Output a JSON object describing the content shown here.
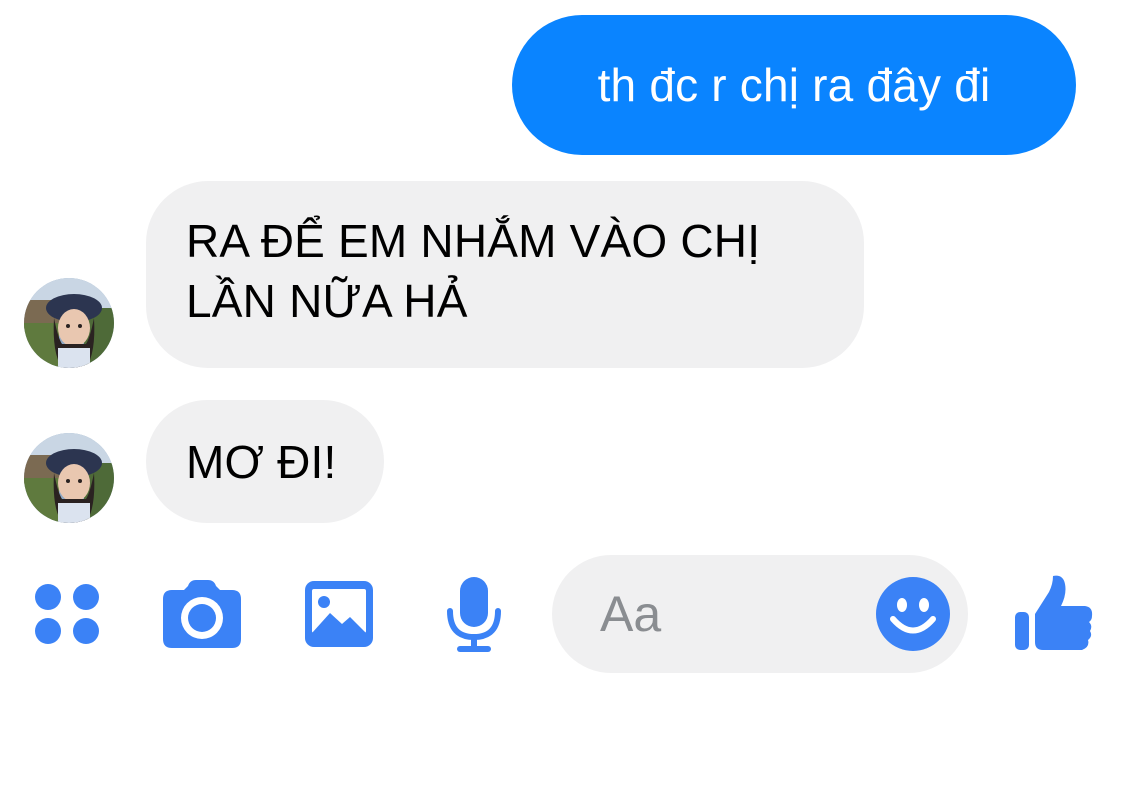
{
  "messages": [
    {
      "direction": "outgoing",
      "text": "th đc r chị ra đây đi"
    },
    {
      "direction": "incoming",
      "lines": [
        "RA ĐỂ EM NHẮM VÀO CHỊ",
        "LẦN NỮA HẢ"
      ]
    },
    {
      "direction": "incoming",
      "text": "MƠ ĐI!"
    }
  ],
  "composer": {
    "placeholder": "Aa",
    "value": ""
  },
  "toolbar": {
    "icons": [
      "apps-icon",
      "camera-icon",
      "photo-icon",
      "microphone-icon",
      "emoji-icon",
      "thumbs-up-icon"
    ]
  },
  "colors": {
    "accent": "#0a84ff",
    "icon_blue": "#3b82f6",
    "incoming_bubble": "#f0f0f1",
    "composer_bg": "#f0f0f1",
    "placeholder": "#8a8d91"
  }
}
